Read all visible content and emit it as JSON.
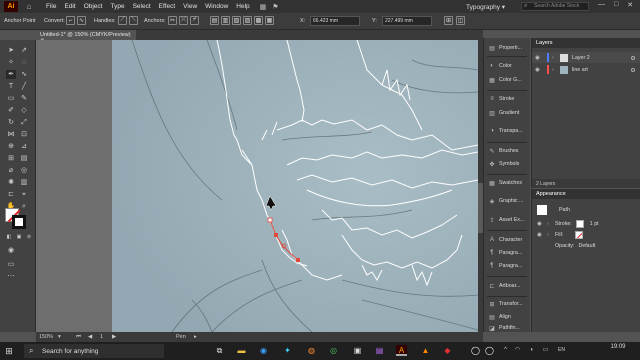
{
  "app": {
    "logo": "Ai",
    "menus": [
      "File",
      "Edit",
      "Object",
      "Type",
      "Select",
      "Effect",
      "View",
      "Window",
      "Help"
    ],
    "workspace": "Typography",
    "search_placeholder": "Search Adobe Stock"
  },
  "control_bar": {
    "tool_label": "Anchor Point",
    "convert_label": "Convert:",
    "handles_label": "Handles:",
    "anchors_label": "Anchors:",
    "x_value": "66.423 mm",
    "y_value": "227.499 mm"
  },
  "document": {
    "tab_title": "Untitled-1* @ 150% (CMYK/Preview)",
    "zoom": "150%",
    "page": "1",
    "status": "Pen"
  },
  "dock": {
    "items": [
      "Properti...",
      "Color",
      "Color G...",
      "Stroke",
      "Gradient",
      "Transpa...",
      "Brushes",
      "Symbols",
      "Swatches",
      "Graphic ...",
      "Asset Ex...",
      "Character",
      "Paragra...",
      "Paragra...",
      "Artboar...",
      "Transfor...",
      "Align",
      "Pathfin..."
    ]
  },
  "layers": {
    "tab_label": "Layers",
    "rows": [
      {
        "name": "Layer 2",
        "color": "#4f7cff"
      },
      {
        "name": "line art",
        "color": "#ff4f4f"
      }
    ],
    "footer": "2 Layers"
  },
  "appearance": {
    "tab_label": "Appearance",
    "object_label": "Path",
    "stroke_label": "Stroke:",
    "stroke_value": "1 pt",
    "fill_label": "Fill:",
    "opacity_label": "Opacity:",
    "opacity_value": "Default"
  },
  "taskbar": {
    "search_placeholder": "Search for anything",
    "time": "19:09"
  }
}
